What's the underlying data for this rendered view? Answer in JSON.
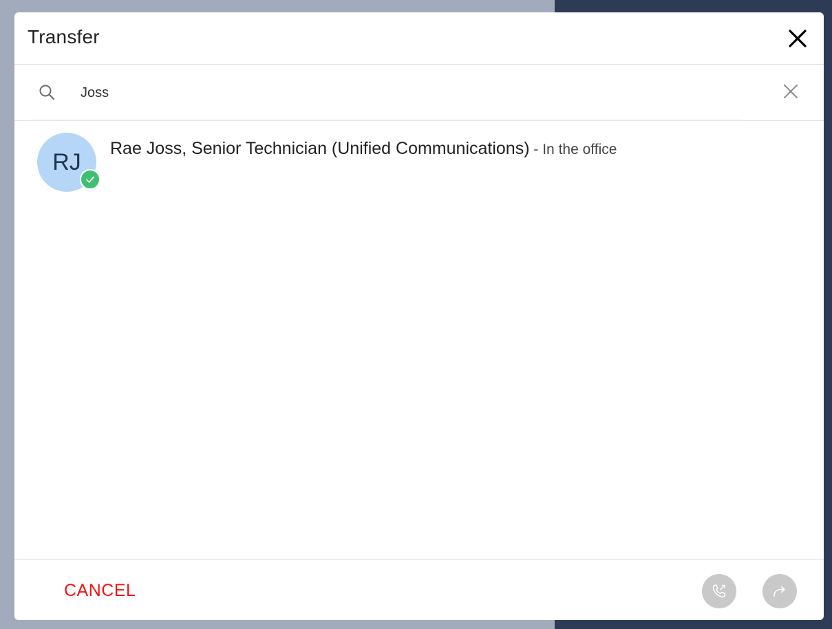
{
  "dialog": {
    "title": "Transfer"
  },
  "search": {
    "value": "Joss"
  },
  "results": [
    {
      "initials": "RJ",
      "name": "Rae Joss, Senior Technician (Unified Communications)",
      "separator": " - ",
      "status": "In the office",
      "status_color": "#3fbf72",
      "avatar_color": "#b5d6f6"
    }
  ],
  "footer": {
    "cancel_label": "CANCEL",
    "cancel_color": "#f21313",
    "call_icon": "phone-transfer-icon",
    "forward_icon": "forward-arrow-icon"
  }
}
